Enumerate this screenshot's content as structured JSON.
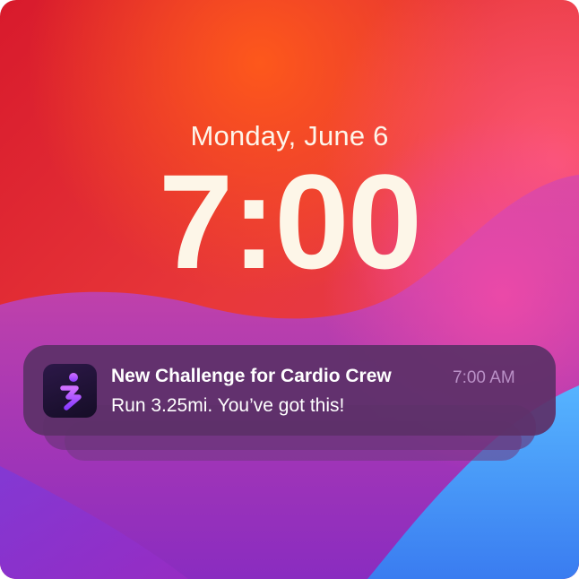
{
  "lock_screen": {
    "date": "Monday, June 6",
    "time": "7:00"
  },
  "notification": {
    "app_icon": "running-figure-icon",
    "title": "New Challenge for Cardio Crew",
    "timestamp": "7:00 AM",
    "body": "Run 3.25mi. You’ve got this!"
  },
  "colors": {
    "clock_text": "#fdf6e8",
    "notification_background": "#5c3068",
    "notification_time": "#b990c6",
    "icon_accent": "#c35cf0"
  }
}
